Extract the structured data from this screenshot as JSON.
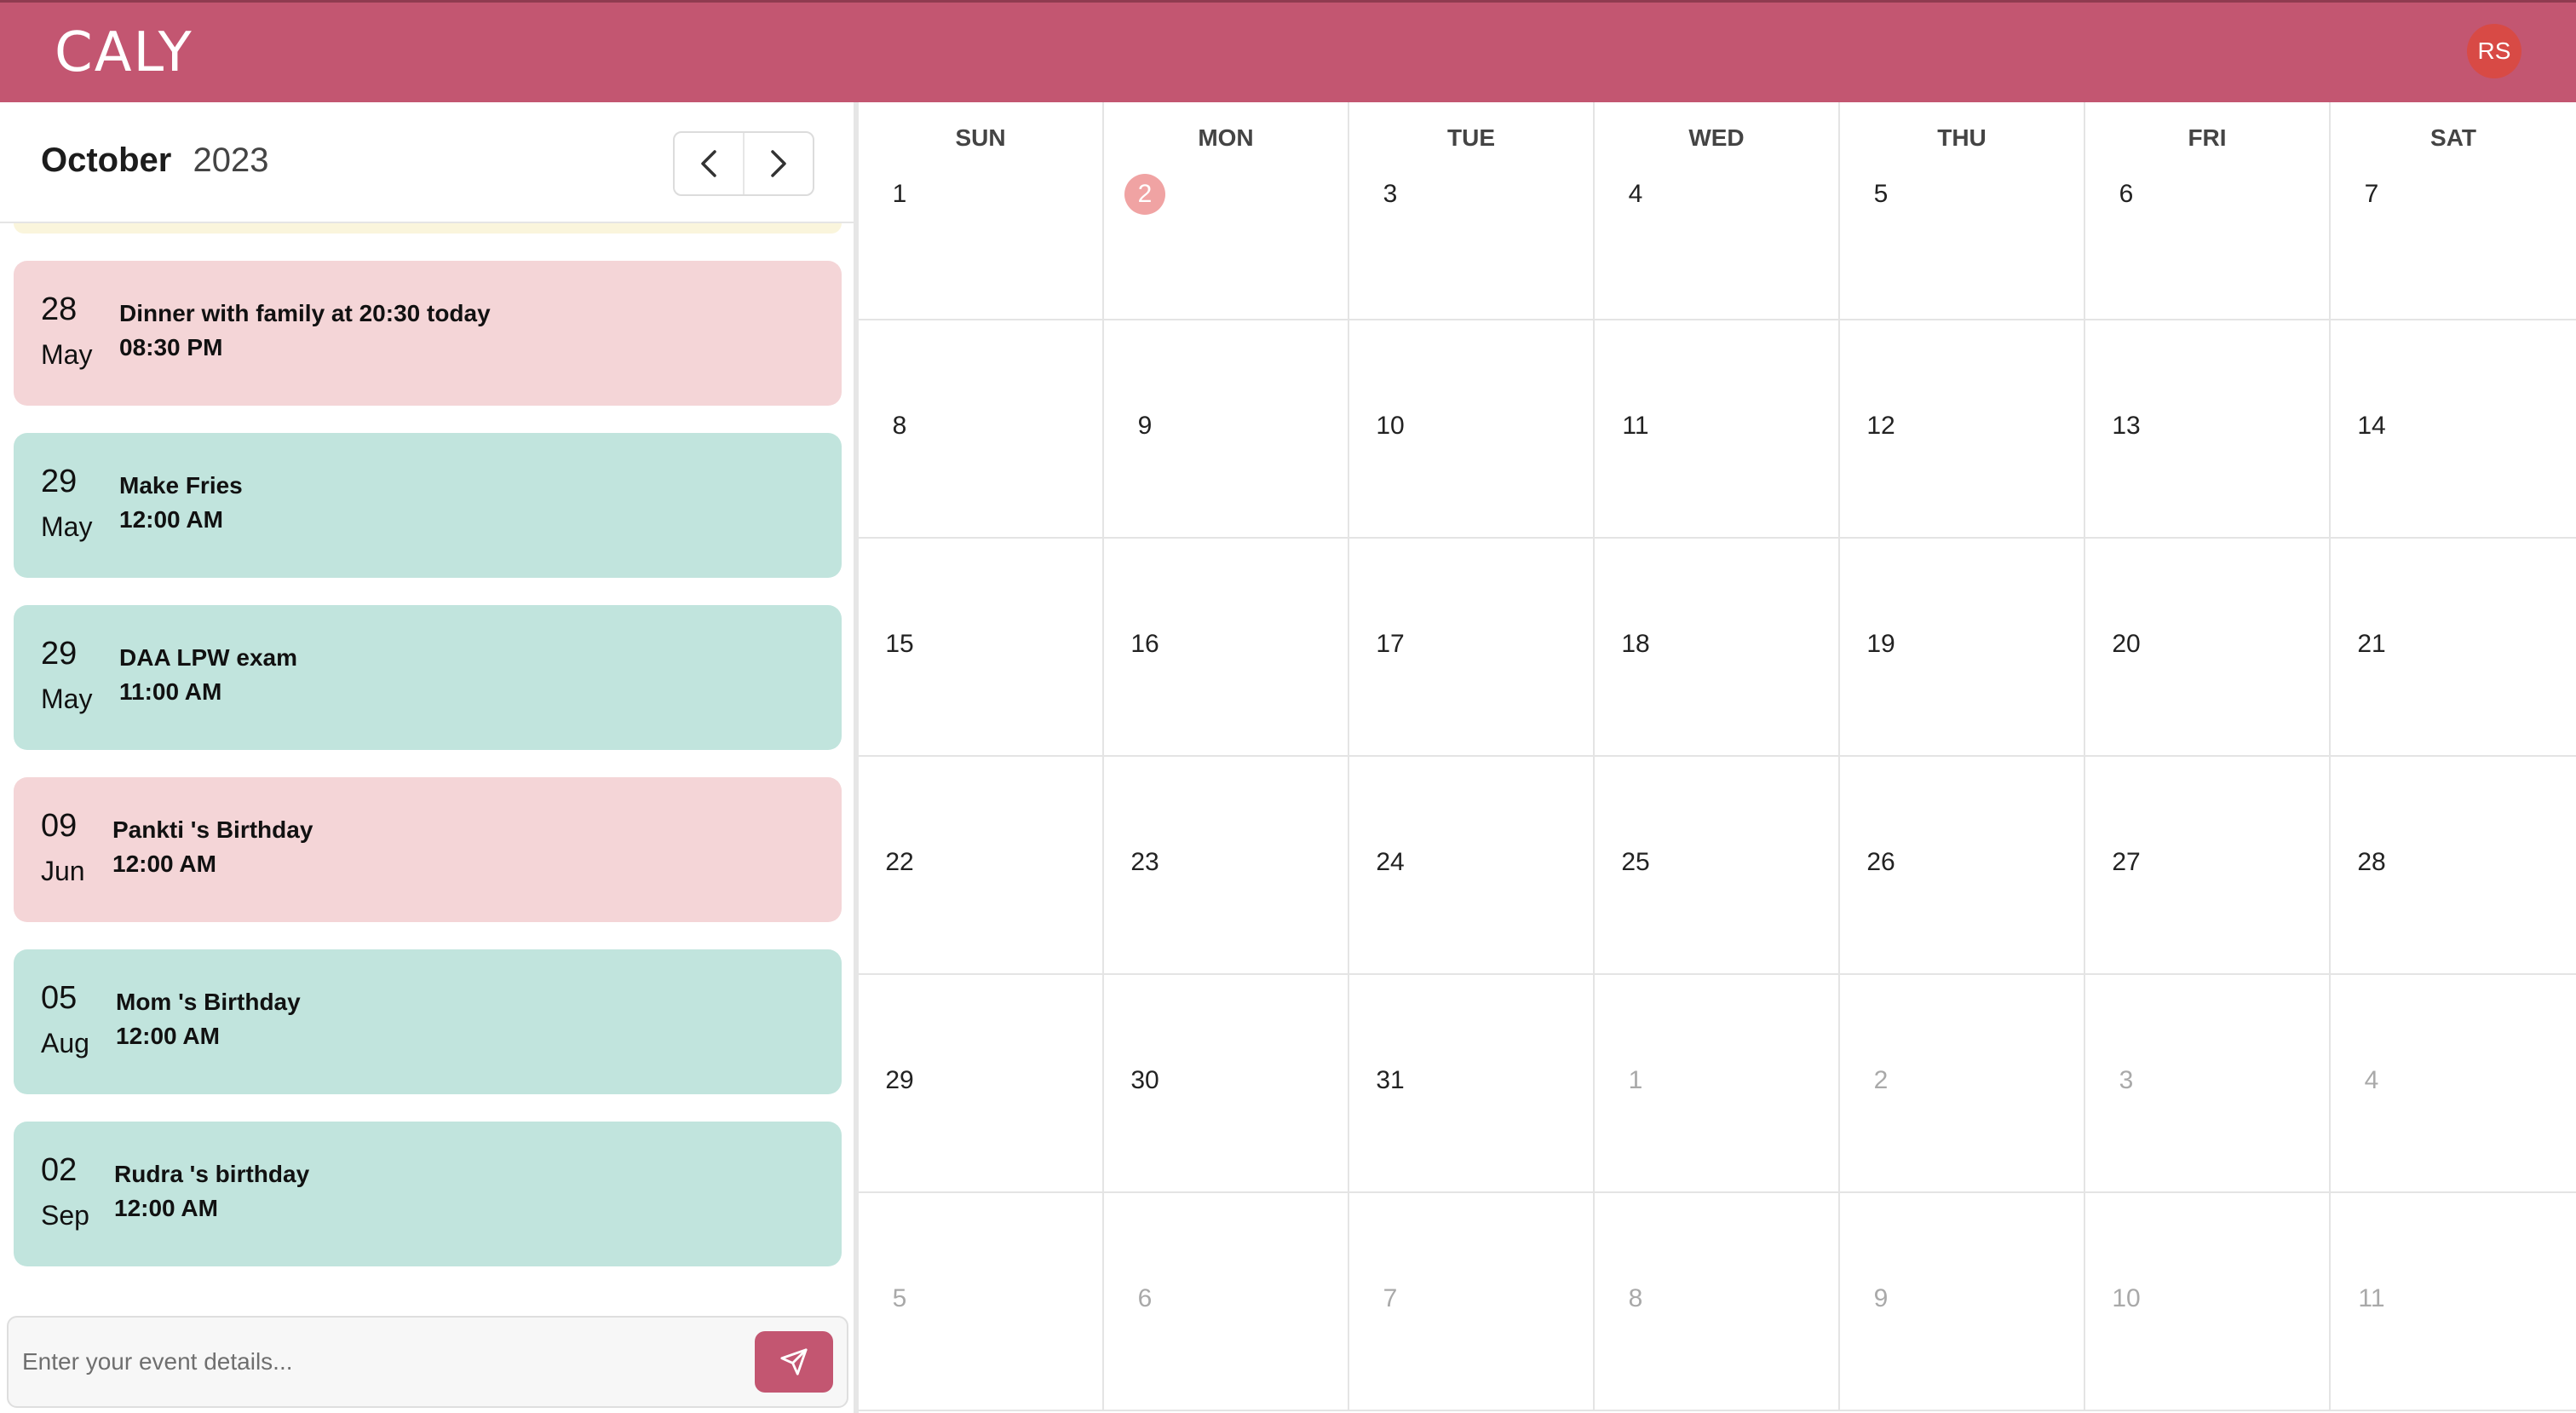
{
  "header": {
    "logo": "CALY",
    "avatar": "RS"
  },
  "sidebar": {
    "month": "October",
    "year": "2023",
    "events": [
      {
        "day": "28",
        "month": "May",
        "title": "Dinner with family at 20:30 today",
        "time": "08:30 PM",
        "color": "pink"
      },
      {
        "day": "29",
        "month": "May",
        "title": "Make Fries",
        "time": "12:00 AM",
        "color": "teal"
      },
      {
        "day": "29",
        "month": "May",
        "title": "DAA LPW exam",
        "time": "11:00 AM",
        "color": "teal"
      },
      {
        "day": "09",
        "month": "Jun",
        "title": "Pankti 's Birthday",
        "time": "12:00 AM",
        "color": "pink"
      },
      {
        "day": "05",
        "month": "Aug",
        "title": "Mom 's Birthday",
        "time": "12:00 AM",
        "color": "teal"
      },
      {
        "day": "02",
        "month": "Sep",
        "title": "Rudra 's birthday",
        "time": "12:00 AM",
        "color": "teal"
      }
    ],
    "input_placeholder": "Enter your event details..."
  },
  "calendar": {
    "weekdays": [
      "SUN",
      "MON",
      "TUE",
      "WED",
      "THU",
      "FRI",
      "SAT"
    ],
    "weeks": [
      [
        "1",
        "2",
        "3",
        "4",
        "5",
        "6",
        "7"
      ],
      [
        "8",
        "9",
        "10",
        "11",
        "12",
        "13",
        "14"
      ],
      [
        "15",
        "16",
        "17",
        "18",
        "19",
        "20",
        "21"
      ],
      [
        "22",
        "23",
        "24",
        "25",
        "26",
        "27",
        "28"
      ],
      [
        "29",
        "30",
        "31",
        "1",
        "2",
        "3",
        "4"
      ],
      [
        "5",
        "6",
        "7",
        "8",
        "9",
        "10",
        "11"
      ]
    ],
    "today": "2",
    "colors": {
      "brand": "#c35671",
      "today": "#f0a3a3",
      "pink_event": "#f4d5d7",
      "teal_event": "#c1e4dd"
    }
  }
}
